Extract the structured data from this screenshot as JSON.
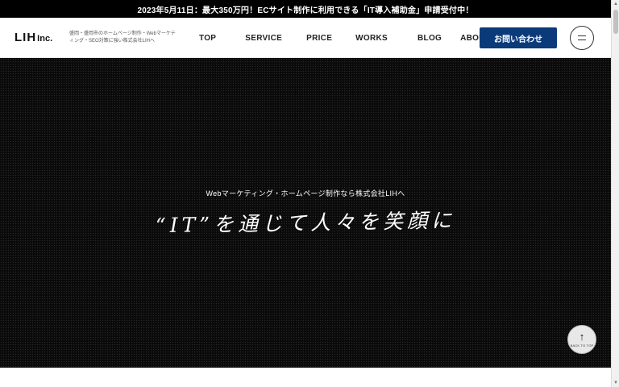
{
  "announcement": {
    "text": "2023年5月11日：最大350万円！ECサイト制作に利用できる「IT導入補助金」申請受付中！"
  },
  "header": {
    "logo_main": "LIH",
    "logo_inc": "Inc.",
    "tagline": "盛岡・盛岡市のホームページ制作・Webマーケティング・SEO対策に強い株式会社LIHへ",
    "nav": [
      {
        "label": "TOP"
      },
      {
        "label": "SERVICE"
      },
      {
        "label": "PRICE"
      },
      {
        "label": "WORKS"
      },
      {
        "label": "BLOG"
      },
      {
        "label": "ABOUT US"
      }
    ],
    "contact_label": "お問い合わせ"
  },
  "hero": {
    "subtitle": "Webマーケティング・ホームページ制作なら株式会社LIHへ",
    "title": "“IT”を通じて人々を笑顔に"
  },
  "back_to_top": {
    "arrow": "↑",
    "label": "BACK TO TOP"
  },
  "colors": {
    "accent": "#0b3a7a",
    "hero_bg": "#0a0a0a",
    "announce_bg": "#000000"
  }
}
